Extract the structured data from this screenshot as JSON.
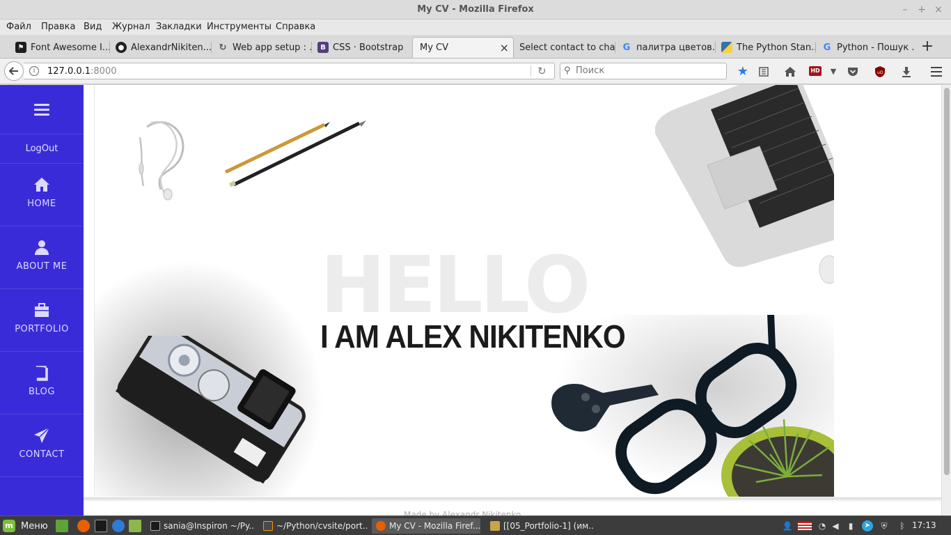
{
  "window": {
    "title": "My CV - Mozilla Firefox",
    "minimize": "–",
    "maximize": "+",
    "close": "×"
  },
  "menu": [
    "Файл",
    "Правка",
    "Вид",
    "Журнал",
    "Закладки",
    "Инструменты",
    "Справка"
  ],
  "tabs": [
    {
      "label": "Font Awesome I...",
      "icon": "font-awesome-icon",
      "color": "#1d1d1d"
    },
    {
      "label": "AlexandrNikiten...",
      "icon": "github-icon",
      "color": "#222222"
    },
    {
      "label": "Web app setup : ...",
      "icon": "pythonanywhere-icon",
      "color": "#555555"
    },
    {
      "label": "CSS · Bootstrap",
      "icon": "bootstrap-icon",
      "color": "#563d7c"
    },
    {
      "label": "My CV",
      "icon": "none",
      "active": true
    },
    {
      "label": "Select contact to cha...",
      "icon": "none"
    },
    {
      "label": "палитра цветов...",
      "icon": "google-icon",
      "color": "#4285f4"
    },
    {
      "label": "The Python Stan...",
      "icon": "python-icon",
      "color": "#3572a5"
    },
    {
      "label": "Python - Пошук ...",
      "icon": "google-icon",
      "color": "#4285f4"
    }
  ],
  "tab_close": "×",
  "new_tab": "+",
  "navbar": {
    "url_host": "127.0.0.1",
    "url_port": ":8000",
    "search_placeholder": "Поиск"
  },
  "sidebar": {
    "logout": "LogOut",
    "items": [
      {
        "label": "HOME",
        "icon": "home-icon"
      },
      {
        "label": "ABOUT ME",
        "icon": "user-icon"
      },
      {
        "label": "PORTFOLIO",
        "icon": "briefcase-icon"
      },
      {
        "label": "BLOG",
        "icon": "book-icon"
      },
      {
        "label": "CONTACT",
        "icon": "paper-plane-icon"
      }
    ],
    "color": "#3a2bd9"
  },
  "hero": {
    "hello": "HELLO",
    "name": "I AM ALEX NIKITENKO"
  },
  "footer_peek": "Made by Alexandr Nikitenko",
  "taskbar": {
    "menu_label": "Меню",
    "tasks": [
      {
        "label": "sania@Inspiron ~/Py...",
        "icon": "terminal-icon"
      },
      {
        "label": "~/Python/cvsite/port...",
        "icon": "sublime-icon"
      },
      {
        "label": "My CV - Mozilla Firef...",
        "icon": "firefox-icon",
        "active": true
      },
      {
        "label": "[[05_Portfolio-1] (им...",
        "icon": "image-viewer-icon"
      }
    ],
    "clock": "17:13"
  }
}
